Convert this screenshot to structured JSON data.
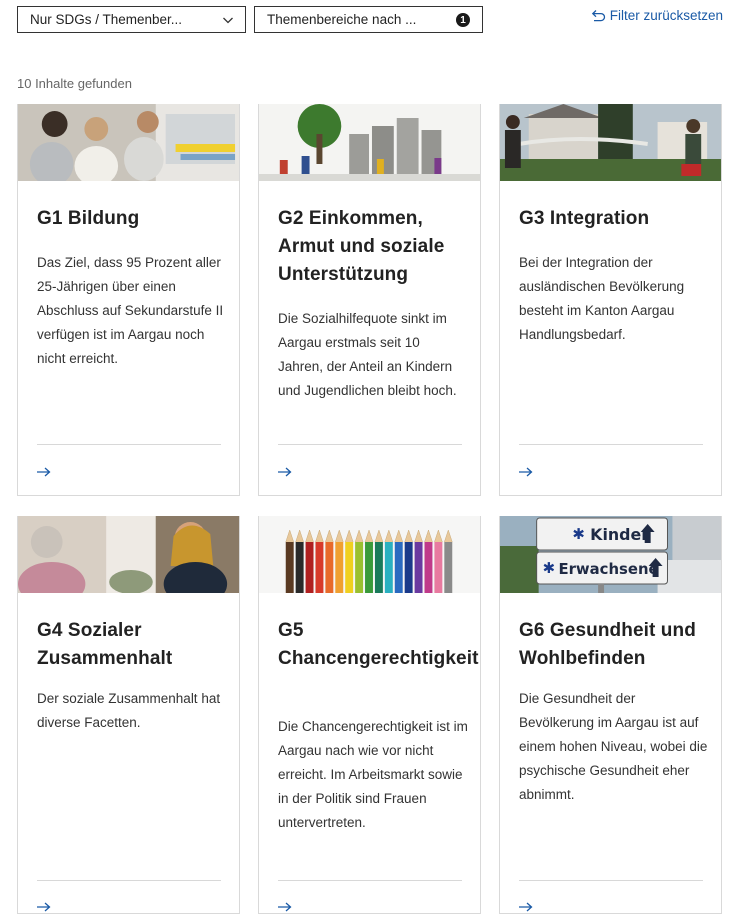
{
  "filters": {
    "sdg_select": "Nur SDGs / Themenber...",
    "theme_select": "Themenbereiche nach ...",
    "theme_badge": "1",
    "reset_label": "Filter zurücksetzen"
  },
  "results": {
    "count_label": "10 Inhalte gefunden"
  },
  "cards": [
    {
      "title": "G1 Bildung",
      "description": "Das Ziel, dass 95 Prozent aller 25-Jährigen über einen Abschluss auf Sekundarstufe II verfügen ist im Aargau noch nicht erreicht.",
      "arrow": "→"
    },
    {
      "title": "G2 Einkommen, Armut und soziale Unterstützung",
      "description": "Die Sozialhilfequote sinkt im Aargau erstmals seit 10 Jahren, der Anteil an Kindern und Jugendlichen bleibt hoch.",
      "arrow": "→"
    },
    {
      "title": "G3 Integration",
      "description": "Bei der Integration der ausländischen Bevölkerung besteht im Kanton Aargau Handlungsbedarf.",
      "arrow": "→"
    },
    {
      "title": "G4 Sozialer Zusammenhalt",
      "description": "Der soziale Zusammenhalt hat diverse Facetten.",
      "arrow": "→"
    },
    {
      "title": "G5 Chancengerechtigkeit",
      "description": "Die Chancengerechtigkeit ist im Aargau nach wie vor nicht erreicht. Im Arbeitsmarkt sowie in der Politik sind Frauen untervertreten.",
      "arrow": "→"
    },
    {
      "title": "G6 Gesundheit und Wohlbefinden",
      "description": "Die Gesundheit der Bevölkerung im Aargau ist auf einem hohen Niveau, wobei die psychische Gesundheit eher abnimmt.",
      "arrow": "→"
    }
  ],
  "sign_text": {
    "kinder": "Kinder",
    "erwachsene": "Erwachsene"
  },
  "colors": {
    "link": "#1a5aa6",
    "border": "#d9d9d9",
    "text": "#333333"
  }
}
